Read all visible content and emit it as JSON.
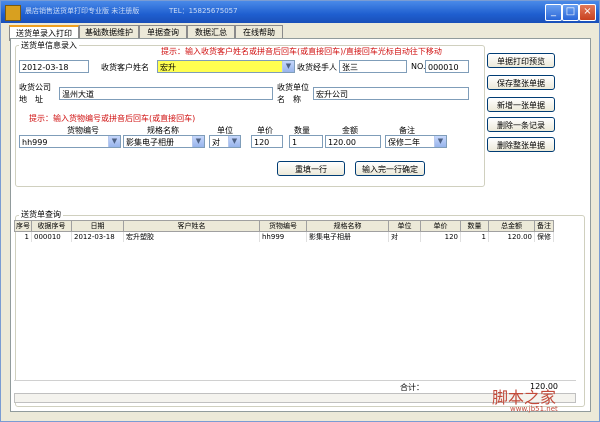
{
  "window": {
    "title": "晨店销售送货单打印专业版 未注册版",
    "phone": "TEL：15825675057",
    "controls": [
      "_",
      "□",
      "×"
    ]
  },
  "tabs": [
    "送货单录入打印",
    "基础数据维护",
    "单据查询",
    "数据汇总",
    "在线帮助"
  ],
  "entry": {
    "group_title": "送货单信息录入",
    "hint_top": "提示：输入收货客户姓名或拼音后回车(或直接回车)/直接回车光标自动往下移动",
    "date_value": "2012-03-18",
    "customer_label": "收货客户姓名",
    "customer_value": "宏升",
    "handler_label": "收货经手人",
    "handler_value": "张三",
    "no_label": "NO.",
    "no_value": "000010",
    "company_addr_label_1": "收货公司",
    "company_addr_label_2": "地　址",
    "company_addr_value": "温州大道",
    "unit_name_label_1": "收货单位",
    "unit_name_label_2": "名　称",
    "unit_name_value": "宏升公司",
    "hint_goods": "提示：输入货物编号或拼音后回车(或直接回车)",
    "col_labels": {
      "goods_no": "货物编号",
      "spec": "规格名称",
      "unit": "单位",
      "price": "单价",
      "qty": "数量",
      "amount": "金额",
      "remark": "备注"
    },
    "goods_no_value": "hh999",
    "spec_value": "影集电子相册",
    "unit_value": "对",
    "price_value": "120",
    "qty_value": "1",
    "amount_value": "120.00",
    "remark_value": "保修二年",
    "refill_button": "重填一行",
    "confirm_button": "输入完一行确定"
  },
  "actions": [
    "单据打印预览",
    "保存整张单据",
    "新增一张单据",
    "删除一条记录",
    "删除整张单据"
  ],
  "query": {
    "group_title": "送货单查询",
    "columns": [
      "序号",
      "收据序号",
      "日期",
      "客户姓名",
      "货物编号",
      "规格名称",
      "单位",
      "单价",
      "数量",
      "总金额",
      "备注"
    ],
    "rows": [
      [
        "1",
        "000010",
        "2012-03-18",
        "宏升塑胶",
        "hh999",
        "影集电子相册",
        "对",
        "120",
        "1",
        "120.00",
        "保修"
      ]
    ],
    "total_label": "合计：",
    "total_value": "120.00"
  },
  "watermark": {
    "brand": "脚本之家",
    "url": "www.jb51.net"
  },
  "colors": {
    "titlebar": "#1f5fd0",
    "hint_red": "#d01010",
    "highlight_yellow": "#ffff50",
    "watermark": "#c24a3a"
  }
}
